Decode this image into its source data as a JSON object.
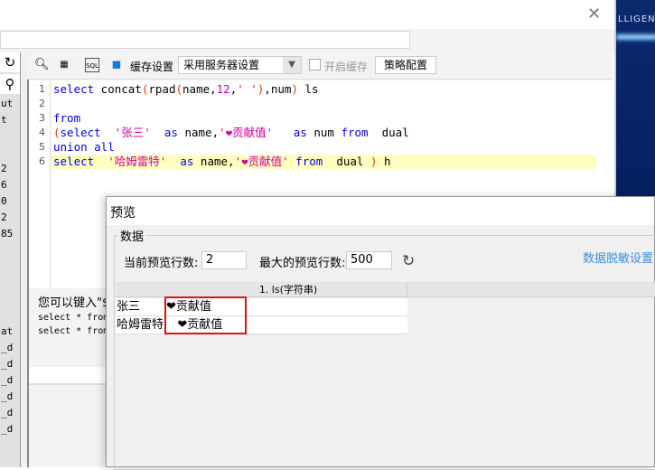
{
  "window": {
    "close_icon": "close-icon",
    "brand_fragment": "LLIGEN"
  },
  "left_panel": {
    "fragments": [
      "ut",
      "t",
      "2",
      "6",
      "0",
      "2",
      "85",
      "at",
      "_d",
      "_d",
      "_d",
      "_d",
      "_d",
      "_d"
    ]
  },
  "toolbar": {
    "cache_label": "缓存设置",
    "cache_select": "采用服务器设置",
    "enable_cache": "开启缓存",
    "enable_cache_checked": false,
    "policy_button": "策略配置"
  },
  "editor": {
    "line_numbers": [
      "1",
      "2",
      "3",
      "4",
      "5",
      "6"
    ],
    "highlighted_line": 6
  },
  "hint": {
    "text": "您可以键入\"$",
    "line1": "select * from",
    "line2": "select * from"
  },
  "preview": {
    "title": "预览",
    "group": "数据",
    "current_rows_label": "当前预览行数:",
    "current_rows": "2",
    "max_rows_label": "最大的预览行数:",
    "max_rows": "500",
    "mask_link": "数据脱敏设置",
    "column_header": "1.  ls(字符串)",
    "rows": [
      {
        "label": "张三",
        "value": "❤贡献值"
      },
      {
        "label": "哈姆雷特",
        "value": "   ❤贡献值"
      }
    ]
  },
  "colors": {
    "keyword": "#0000e0",
    "string": "#d0009a",
    "link": "#3d8fe0",
    "highlight": "#ffffc2",
    "annotation": "#e01020"
  }
}
